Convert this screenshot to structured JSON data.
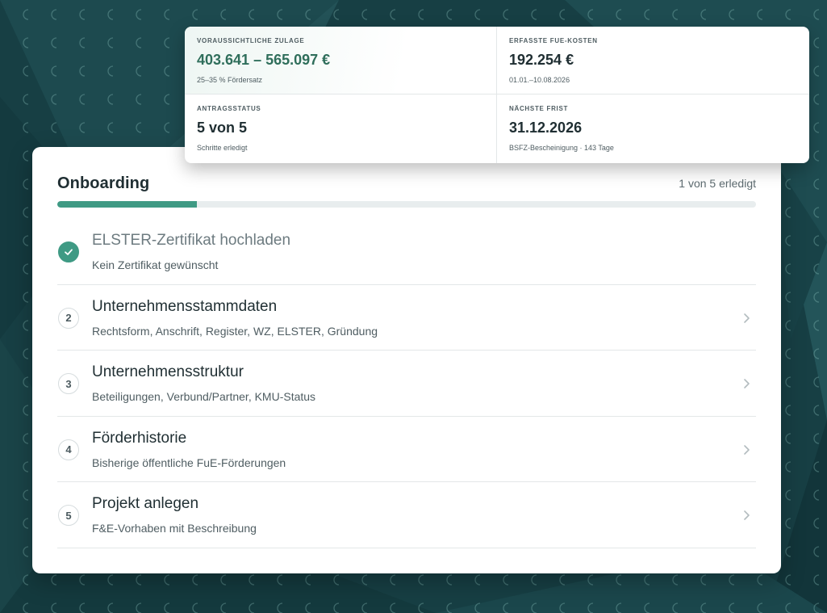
{
  "kpis": {
    "zulage": {
      "label": "VORAUSSICHTLICHE ZULAGE",
      "value": "403.641 – 565.097 €",
      "sub": "25–35 % Fördersatz"
    },
    "kosten": {
      "label": "ERFASSTE FUE-KOSTEN",
      "value": "192.254 €",
      "sub": "01.01.–10.08.2026"
    },
    "status": {
      "label": "ANTRAGSSTATUS",
      "value": "5 von 5",
      "sub": "Schritte erledigt"
    },
    "frist": {
      "label": "NÄCHSTE FRIST",
      "value": "31.12.2026",
      "sub": "BSFZ-Bescheinigung · 143 Tage"
    }
  },
  "onboarding": {
    "title": "Onboarding",
    "count": "1 von 5 erledigt",
    "progress": 0.2,
    "accent": "#3f9a84",
    "steps": [
      {
        "number": "",
        "title": "ELSTER-Zertifikat hochladen",
        "subtitle": "Kein Zertifikat gewünscht",
        "done": true
      },
      {
        "number": "2",
        "title": "Unternehmensstammdaten",
        "subtitle": "Rechtsform, Anschrift, Register, WZ, ELSTER, Gründung",
        "done": false
      },
      {
        "number": "3",
        "title": "Unternehmensstruktur",
        "subtitle": "Beteiligungen, Verbund/Partner, KMU-Status",
        "done": false
      },
      {
        "number": "4",
        "title": "Förderhistorie",
        "subtitle": "Bisherige öffentliche FuE-Förderungen",
        "done": false
      },
      {
        "number": "5",
        "title": "Projekt anlegen",
        "subtitle": "F&E-Vorhaben mit Beschreibung",
        "done": false
      }
    ]
  },
  "icons": {
    "done": "check-icon",
    "next": "chevron-right-icon"
  }
}
